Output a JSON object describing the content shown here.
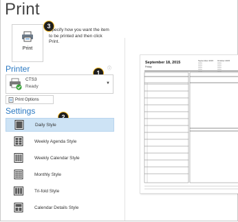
{
  "page": {
    "title": "Print"
  },
  "print_button": {
    "label": "Print",
    "badge": "3"
  },
  "description": "Specify how you want the item to be printed and then click Print.",
  "printer": {
    "section_title": "Printer",
    "info_glyph": "ⓘ",
    "name": "CTS3",
    "status": "Ready",
    "badge": "1",
    "options_label": "Print Options"
  },
  "settings": {
    "section_title": "Settings",
    "badge": "2",
    "styles": [
      {
        "label": "Daily Style",
        "icon": "daily-style-icon",
        "selected": true
      },
      {
        "label": "Weekly Agenda Style",
        "icon": "weekly-agenda-style-icon",
        "selected": false
      },
      {
        "label": "Weekly Calendar Style",
        "icon": "weekly-calendar-style-icon",
        "selected": false
      },
      {
        "label": "Monthly Style",
        "icon": "monthly-style-icon",
        "selected": false
      },
      {
        "label": "Tri-fold Style",
        "icon": "tri-fold-style-icon",
        "selected": false
      },
      {
        "label": "Calendar Details Style",
        "icon": "calendar-details-style-icon",
        "selected": false
      }
    ]
  },
  "preview": {
    "date": "September 18, 2015",
    "day": "Friday",
    "mini_cal_1": "September 2015",
    "mini_cal_2": "October 2015"
  },
  "colors": {
    "accent": "#2b79c2",
    "selected_bg": "#cde3f5",
    "badge_ring": "#f3b51a"
  }
}
